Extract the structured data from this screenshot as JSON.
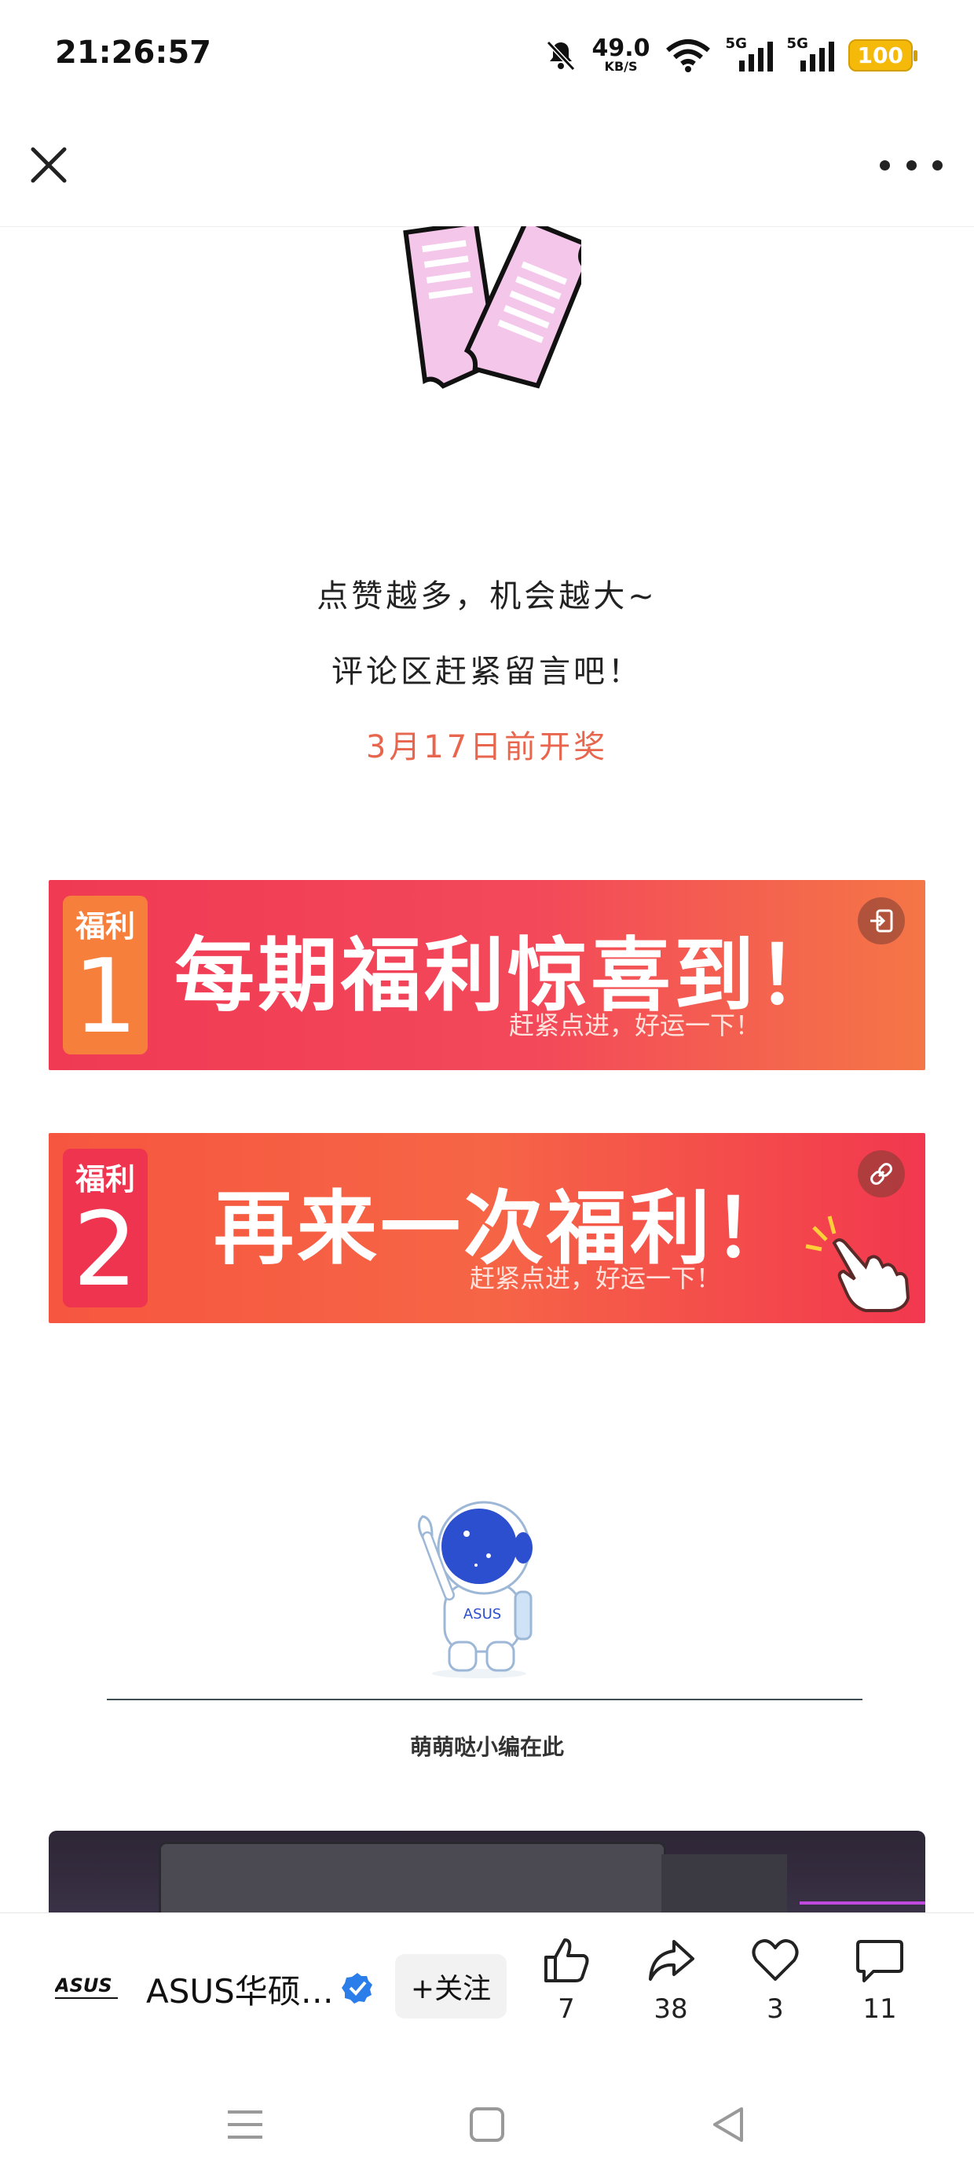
{
  "status_bar": {
    "time": "21:26:57",
    "net_speed_value": "49.0",
    "net_speed_unit": "KB/S",
    "signal1_label": "5G",
    "signal2_label": "5G",
    "battery": "100",
    "icons": [
      "mute-bell-icon",
      "wifi-icon",
      "signal-icon",
      "signal-icon",
      "battery-icon"
    ]
  },
  "top_bar": {
    "close_icon": "close-icon",
    "more_icon": "more-icon"
  },
  "article": {
    "line1": "点赞越多，机会越大~",
    "line2": "评论区赶紧留言吧！",
    "deadline": "3月17日前开奖",
    "deadline_color": "#e8664e",
    "banners": [
      {
        "badge_label": "福利",
        "badge_number": "1",
        "title": "每期福利惊喜到！",
        "subtitle": "赶紧点进，好运一下！",
        "icon": "enter-icon"
      },
      {
        "badge_label": "福利",
        "badge_number": "2",
        "title": "再来一次福利！",
        "subtitle": "赶紧点进，好运一下！",
        "icon": "link-icon"
      }
    ],
    "mascot_text": "ASUS",
    "editor_caption": "萌萌哒小编在此"
  },
  "bottom_bar": {
    "brand_logo_text": "ASUS",
    "account_name": "ASUS华硕…",
    "follow_label": "+关注",
    "actions": [
      {
        "icon": "thumbs-up-icon",
        "count": "7"
      },
      {
        "icon": "share-icon",
        "count": "38"
      },
      {
        "icon": "heart-icon",
        "count": "3"
      },
      {
        "icon": "comment-icon",
        "count": "11"
      }
    ]
  },
  "nav_bar": {
    "icons": [
      "menu-icon",
      "home-icon",
      "back-icon"
    ]
  }
}
